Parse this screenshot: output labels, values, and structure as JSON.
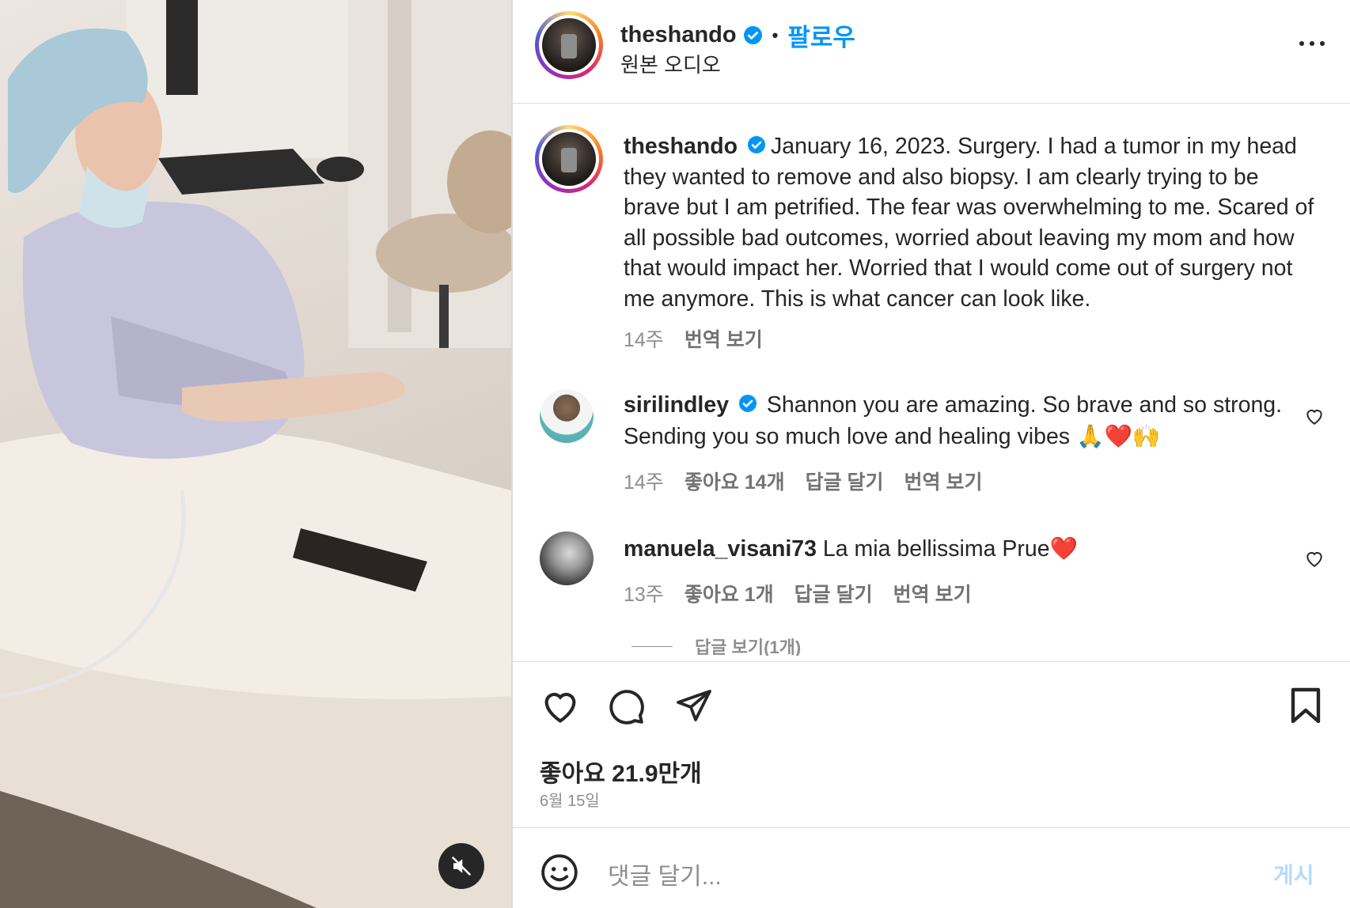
{
  "post": {
    "username": "theshando",
    "follow_label": "팔로우",
    "audio_label": "원본 오디오",
    "more_label": "more-options",
    "caption_username": "theshando",
    "caption_text": "January 16, 2023. Surgery. I had a tumor in my head they wanted to remove and also biopsy. I am clearly trying to be brave but I am petrified. The fear was overwhelming to me. Scared of all possible bad outcomes, worried about leaving my mom and how that would impact her. Worried that I would come out of surgery not me anymore. This is what cancer can look like.",
    "caption_time": "14주",
    "caption_translate": "번역 보기",
    "likes": "좋아요 21.9만개",
    "date": "6월 15일",
    "comment_placeholder": "댓글 달기...",
    "post_button": "게시"
  },
  "comments": [
    {
      "username": "sirilindley",
      "verified": true,
      "text": "Shannon you are amazing. So brave and so strong. Sending you so much love and healing vibes 🙏❤️🙌",
      "time": "14주",
      "likes": "좋아요 14개",
      "reply": "답글 달기",
      "translate": "번역 보기"
    },
    {
      "username": "manuela_visani73",
      "verified": false,
      "text": "La mia bellissima Prue❤️",
      "time": "13주",
      "likes": "좋아요 1개",
      "reply": "답글 달기",
      "translate": "번역 보기"
    }
  ],
  "view_replies": "답글 보기(1개)",
  "colors": {
    "accent": "#0095f6",
    "text": "#262626",
    "muted": "#8e8e8e",
    "post_disabled": "#b3dbff"
  },
  "icons": [
    "verified-badge-icon",
    "heart-icon",
    "comment-icon",
    "share-icon",
    "bookmark-icon",
    "emoji-icon",
    "mute-icon",
    "more-icon"
  ]
}
